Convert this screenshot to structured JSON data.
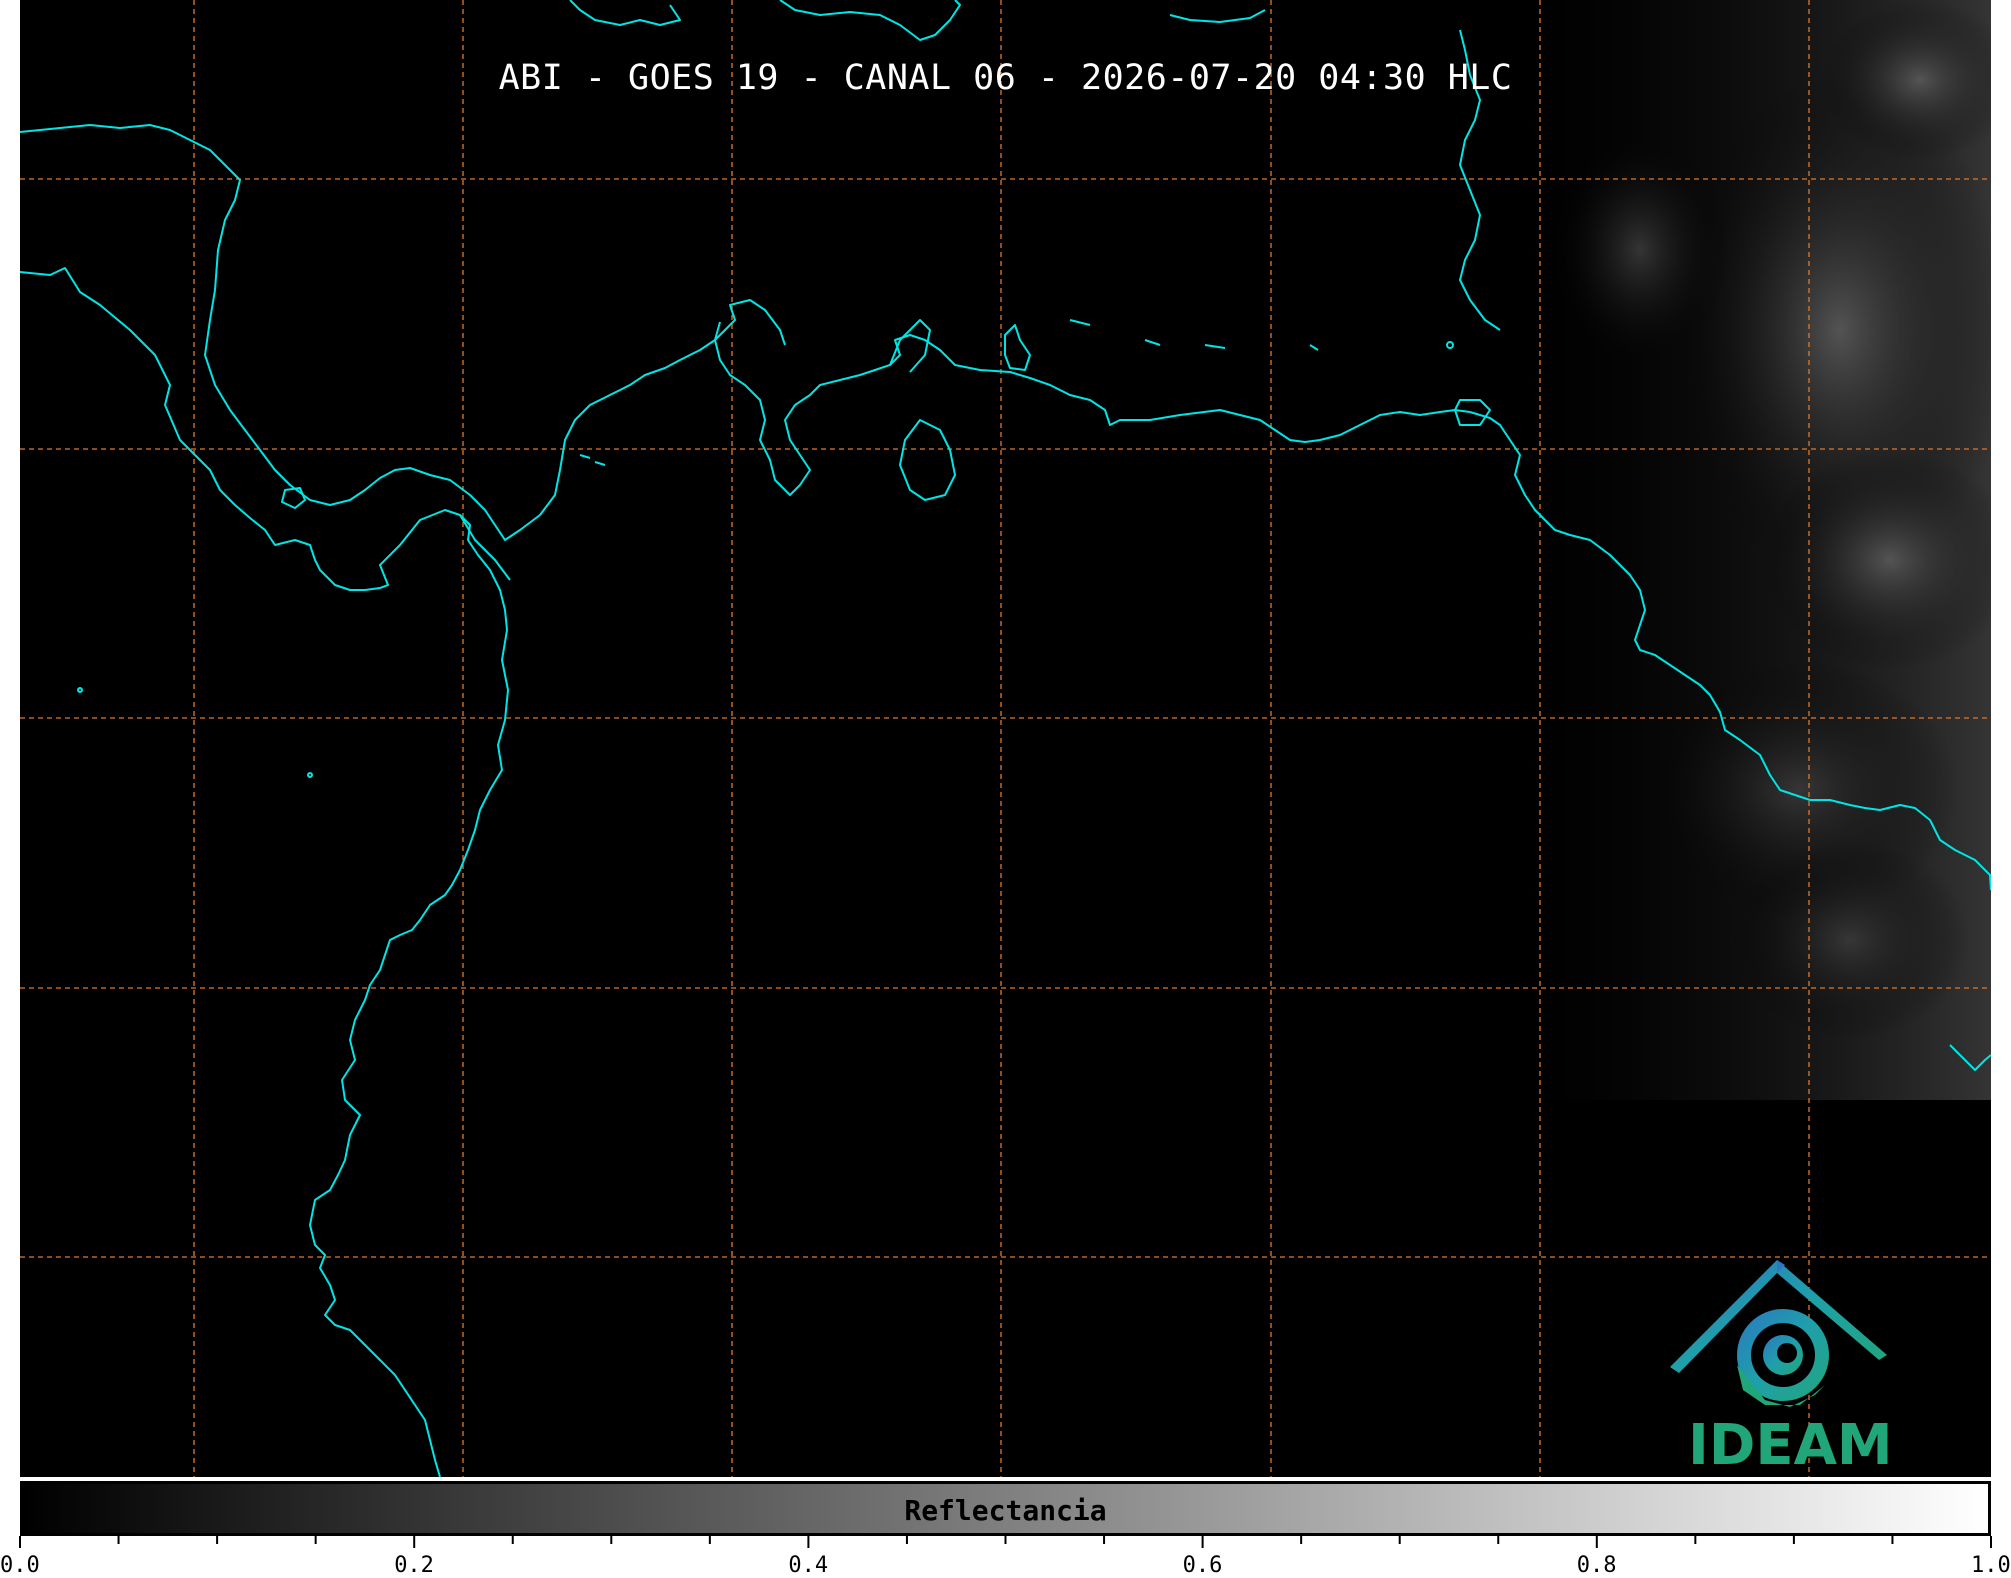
{
  "title": "ABI - GOES 19 - CANAL 06 - 2026-07-20 04:30 HLC",
  "colorbar": {
    "label": "Reflectancia",
    "ticks": [
      "0.0",
      "0.2",
      "0.4",
      "0.6",
      "0.8",
      "1.0"
    ],
    "range": [
      0.0,
      1.0
    ],
    "colormap": [
      "#000000",
      "#ffffff"
    ]
  },
  "logo": {
    "name": "IDEAM",
    "colors": [
      "#2a78c2",
      "#1fa0a8",
      "#21a67a"
    ]
  },
  "colors": {
    "coastline": "#00e5e5",
    "gridline": "#e0782a",
    "background": "#000000"
  }
}
